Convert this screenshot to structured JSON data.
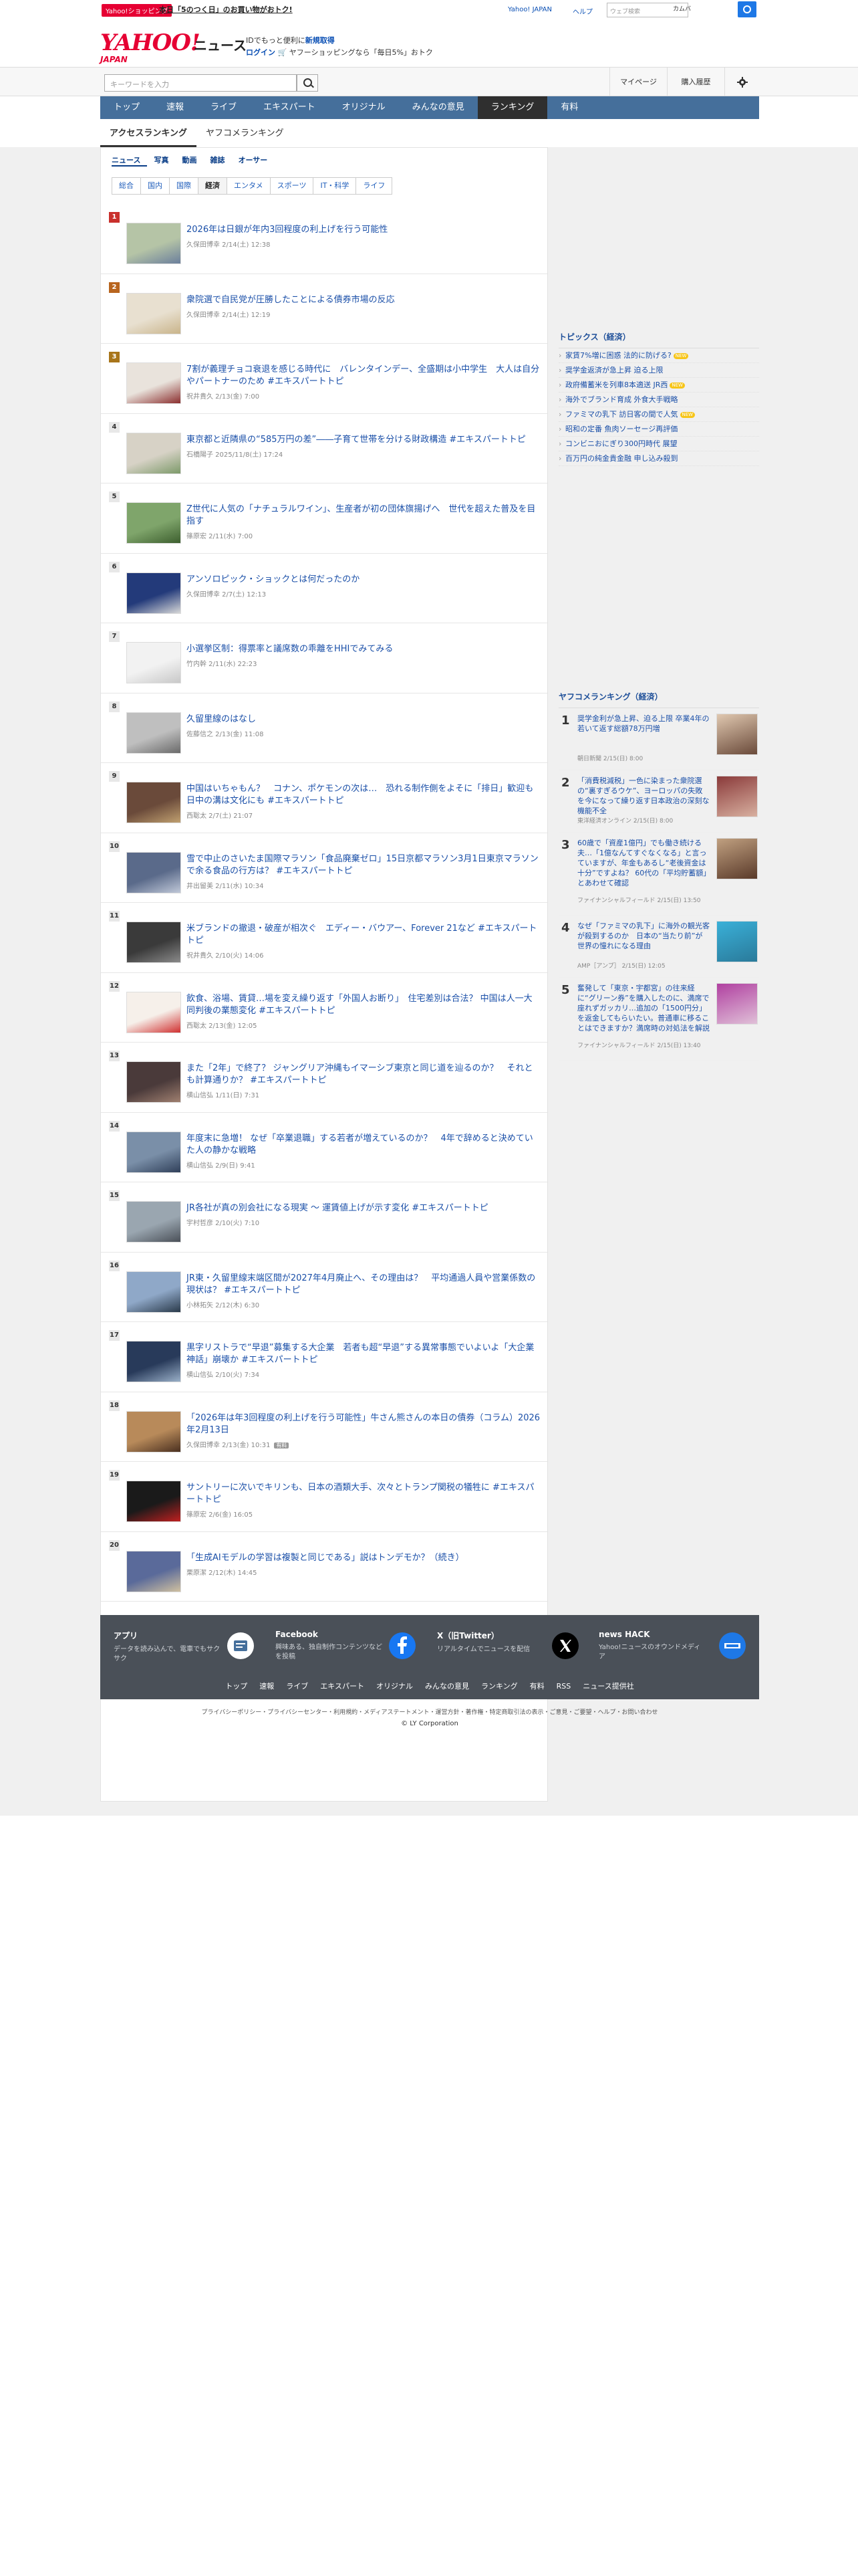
{
  "topbar": {
    "badge": "Yahoo!ショッピング",
    "promo": "本日「5のつく日」のお買い物がおトク!",
    "link1": "Yahoo! JAPAN",
    "link2": "ヘルプ",
    "search_placeholder": "ウェブ検索",
    "search_button": "カムバ"
  },
  "header": {
    "logo": "YAHOO!",
    "logo_sub": "JAPAN",
    "section": "ニュース",
    "line1_pre": "IDでもっと便利に",
    "line1_link": "新規取得",
    "line2_link": "ログイン",
    "line2_text": "ヤフーショッピングなら「毎日5%」おトク"
  },
  "searchbar": {
    "placeholder": "キーワードを入力",
    "mypage": "マイページ",
    "history": "購入履歴"
  },
  "nav": [
    "トップ",
    "速報",
    "ライブ",
    "エキスパート",
    "オリジナル",
    "みんなの意見",
    "ランキング",
    "有料"
  ],
  "subtabs": [
    "アクセスランキング",
    "ヤフコメランキング"
  ],
  "categories": [
    "ニュース",
    "写真",
    "動画",
    "雑誌",
    "オーサー"
  ],
  "genres": [
    "総合",
    "国内",
    "国際",
    "経済",
    "エンタメ",
    "スポーツ",
    "IT・科学",
    "ライフ"
  ],
  "ranking": [
    {
      "rank": "1",
      "title": "2026年は日銀が年内3回程度の利上げを行う可能性",
      "meta": "久保田博幸  2/14(土) 12:38"
    },
    {
      "rank": "2",
      "title": "衆院選で自民党が圧勝したことによる債券市場の反応",
      "meta": "久保田博幸  2/14(土) 12:19"
    },
    {
      "rank": "3",
      "title": "7割が義理チョコ衰退を感じる時代に　バレンタインデー、全盛期は小中学生　大人は自分やパートナーのため #エキスパートトピ",
      "meta": "祝井貴久  2/13(金) 7:00"
    },
    {
      "rank": "4",
      "title": "東京都と近隣県の“585万円の差”――子育て世帯を分ける財政構造 #エキスパートトピ",
      "meta": "石橋陽子  2025/11/8(土) 17:24"
    },
    {
      "rank": "5",
      "title": "Z世代に人気の「ナチュラルワイン」、生産者が初の団体旗揚げへ　世代を超えた普及を目指す",
      "meta": "篠原宏  2/11(水) 7:00"
    },
    {
      "rank": "6",
      "title": "アンソロピック・ショックとは何だったのか",
      "meta": "久保田博幸  2/7(土) 12:13"
    },
    {
      "rank": "7",
      "title": "小選挙区制：得票率と議席数の乖離をHHIでみてみる",
      "meta": "竹内幹  2/11(水) 22:23"
    },
    {
      "rank": "8",
      "title": "久留里線のはなし",
      "meta": "佐藤信之  2/13(金) 11:08"
    },
    {
      "rank": "9",
      "title": "中国はいちゃもん？　コナン、ポケモンの次は…　恐れる制作側をよそに「排日」歓迎も　日中の溝は文化にも #エキスパートトピ",
      "meta": "西聡太  2/7(土) 21:07"
    },
    {
      "rank": "10",
      "title": "雪で中止のさいたま国際マラソン「食品廃棄ゼロ」15日京都マラソン3月1日東京マラソンで余る食品の行方は？ #エキスパートトピ",
      "meta": "井出留美  2/11(水) 10:34"
    },
    {
      "rank": "11",
      "title": "米ブランドの撤退・破産が相次ぐ　エディー・バウアー、Forever 21など #エキスパートトピ",
      "meta": "祝井貴久  2/10(火) 14:06"
    },
    {
      "rank": "12",
      "title": "飲食、浴場、賃貸…場を変え繰り返す「外国人お断り」　住宅差別は合法？ 中国は人一大同判後の業態変化 #エキスパートトピ",
      "meta": "西聡太  2/13(金) 12:05"
    },
    {
      "rank": "13",
      "title": "また「2年」で終了？ ジャングリア沖縄もイマーシブ東京と同じ道を辿るのか？　それとも計算通りか？ #エキスパートトピ",
      "meta": "横山信弘  1/11(日) 7:31"
    },
    {
      "rank": "14",
      "title": "年度末に急増！ なぜ「卒業退職」する若者が増えているのか？　4年で辞めると決めていた人の静かな戦略",
      "meta": "横山信弘  2/9(日) 9:41"
    },
    {
      "rank": "15",
      "title": "JR各社が真の別会社になる現実 〜 運賃値上げが示す変化 #エキスパートトピ",
      "meta": "宇村哲彦  2/10(火) 7:10"
    },
    {
      "rank": "16",
      "title": "JR東・久留里線末端区間が2027年4月廃止へ、その理由は？　平均通過人員や営業係数の現状は？ #エキスパートトピ",
      "meta": "小林拓矢  2/12(木) 6:30"
    },
    {
      "rank": "17",
      "title": "黒字リストラで“早退”募集する大企業　若者も超“早退”する異常事態でいよいよ「大企業神話」崩壊か #エキスパートトピ",
      "meta": "横山信弘  2/10(火) 7:34"
    },
    {
      "rank": "18",
      "title": "「2026年は年3回程度の利上げを行う可能性」牛さん熊さんの本日の債券（コラム）2026年2月13日",
      "meta": "久保田博幸  2/13(金) 10:31",
      "badge": "有料"
    },
    {
      "rank": "19",
      "title": "サントリーに次いでキリンも、日本の酒類大手、次々とトランプ関税の犠牲に #エキスパートトピ",
      "meta": "篠原宏  2/6(金) 16:05"
    },
    {
      "rank": "20",
      "title": "「生成AIモデルの学習は複製と同じである」説はトンデモか？（続き）",
      "meta": "栗原潔  2/12(木) 14:45"
    }
  ],
  "topics": {
    "heading": "トピックス（経済）",
    "new_label": "NEW",
    "items": [
      {
        "text": "家賃7%増に困惑 法的に防げる?",
        "new": true
      },
      {
        "text": "奨学金返済が急上昇 迫る上限",
        "new": false
      },
      {
        "text": "政府備蓄米を列車8本適送 JR西",
        "new": true
      },
      {
        "text": "海外でブランド育成 外食大手戦略",
        "new": false
      },
      {
        "text": "ファミマの乳下 訪日客の間で人気",
        "new": true
      },
      {
        "text": "昭和の定番 魚肉ソーセージ再評価",
        "new": false
      },
      {
        "text": "コンビニおにぎり300円時代 展望",
        "new": false
      },
      {
        "text": "百万円の純金貴金融 申し込み殺到",
        "new": false
      }
    ]
  },
  "yahoo_comment_ranking": {
    "heading": "ヤフコメランキング（経済）",
    "items": [
      {
        "rank": "1",
        "title": "奨学金利が急上昇、迫る上限 卒業4年の若いて返す総額78万円増",
        "meta": "朝日新聞  2/15(日) 8:00"
      },
      {
        "rank": "2",
        "title": "「消費税減税」一色に染まった衆院選の“裏すぎるウケ”、ヨーロッパの失敗を今になって繰り返す日本政治の深刻な機能不全",
        "meta": "東洋経済オンライン  2/15(日) 8:00"
      },
      {
        "rank": "3",
        "title": "60歳で「資産1億円」でも働き続ける夫…「1億なんてすぐなくなる」と言っていますが、年金もあるし“老後資金は十分”ですよね？ 60代の「平均貯蓄額」とあわせて確認",
        "meta": "ファイナンシャルフィールド  2/15(日) 13:50"
      },
      {
        "rank": "4",
        "title": "なぜ「ファミマの乳下」に海外の観光客が殺到するのか　日本の“当たり前”が世界の憧れになる理由",
        "meta": "AMP［アンプ］  2/15(日) 12:05"
      },
      {
        "rank": "5",
        "title": "奮発して「東京・宇都宮」の往来経に“グリーン券”を購入したのに、満席で座れずガッカリ…追加の「1500円分」を返金してもらいたい。普通車に移ることはできますか？満席時の対処法を解説",
        "meta": "ファイナンシャルフィールド  2/15(日) 13:40"
      }
    ]
  },
  "footer": {
    "apps": [
      {
        "title": "アプリ",
        "desc": "データを読み込んで、電車でもサクサク"
      },
      {
        "title": "Facebook",
        "desc": "興味ある、独自制作コンテンツなどを投稿"
      },
      {
        "title": "X（旧Twitter）",
        "desc": "リアルタイムでニュースを配信"
      },
      {
        "title": "news HACK",
        "desc": "Yahoo!ニュースのオウンドメディア"
      }
    ],
    "links": [
      "トップ",
      "速報",
      "ライブ",
      "エキスパート",
      "オリジナル",
      "みんなの意見",
      "ランキング",
      "有料",
      "RSS",
      "ニュース提供社"
    ],
    "legal": "プライバシーポリシー・プライバシーセンター・利用規約・メディアステートメント・運営方針・著作権・特定商取引法の表示・ご意見・ご要望・ヘルプ・お問い合わせ",
    "copyright": "© LY Corporation"
  }
}
